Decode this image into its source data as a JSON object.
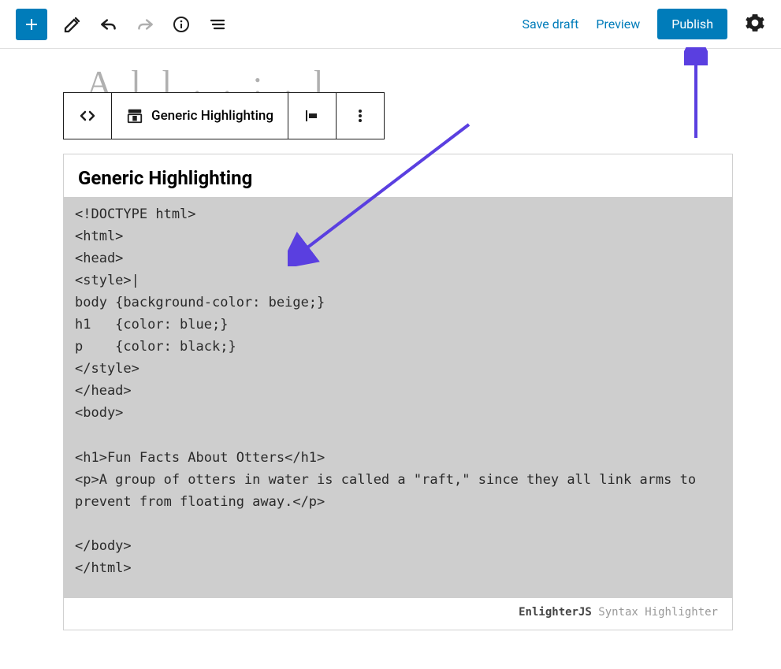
{
  "toolbar": {
    "save_draft": "Save draft",
    "preview": "Preview",
    "publish": "Publish"
  },
  "editor": {
    "title_placeholder": "A  l l . . : . l"
  },
  "block_toolbar": {
    "block_type_label": "Generic Highlighting"
  },
  "block": {
    "heading": "Generic Highlighting",
    "code": "<!DOCTYPE html>\n<html>\n<head>\n<style>|\nbody {background-color: beige;}\nh1   {color: blue;}\np    {color: black;}\n</style>\n</head>\n<body>\n\n<h1>Fun Facts About Otters</h1>\n<p>A group of otters in water is called a \"raft,\" since they all link arms to prevent from floating away.</p>\n\n</body>\n</html>",
    "footer_bold": "EnlighterJS",
    "footer_rest": " Syntax Highlighter"
  },
  "annotations": {
    "arrow_to_code": "arrow pointing to code block",
    "arrow_to_publish": "arrow pointing to publish button"
  }
}
